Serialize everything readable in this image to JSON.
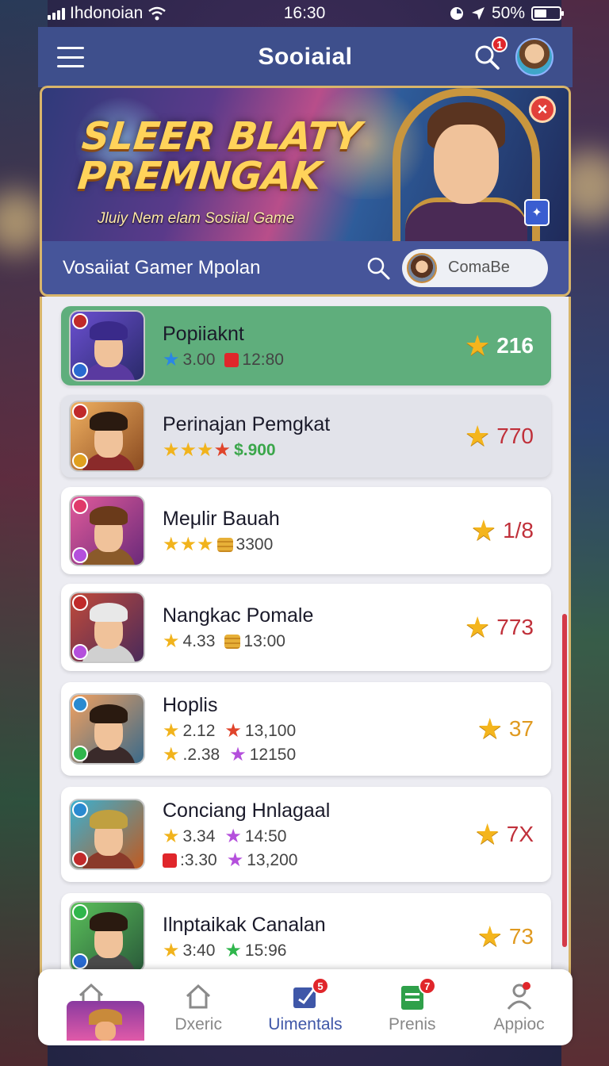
{
  "status_bar": {
    "carrier": "Ihdonoian",
    "time": "16:30",
    "battery": "50%"
  },
  "header": {
    "title": "Sooiaial",
    "search_badge": "1"
  },
  "banner": {
    "title_line1": "SLEER BLATY",
    "title_line2": "PREMNGAK",
    "subtitle": "Jluiy Nem elam Sosiial Game"
  },
  "subheader": {
    "title": "Vosaiiat Gamer Mpolan",
    "pill_label": "ComaBe"
  },
  "games": [
    {
      "name": "Popiiaknt",
      "score": "216",
      "meta": [
        [
          {
            "icon": "blue-star",
            "value": "3.00"
          },
          {
            "icon": "red-gem",
            "value": "12:80"
          }
        ]
      ]
    },
    {
      "name": "Perinajan Pemgkat",
      "score": "770",
      "meta": [
        [
          {
            "icon": "star-rating",
            "value": "$.900"
          }
        ]
      ]
    },
    {
      "name": "Meμlir Bauah",
      "score": "1/8",
      "meta": [
        [
          {
            "icon": "star-rating-3",
            "value": ""
          },
          {
            "icon": "coin",
            "value": "3300"
          }
        ]
      ]
    },
    {
      "name": "Nangkac Pomale",
      "score": "773",
      "meta": [
        [
          {
            "icon": "star",
            "value": "4.33"
          },
          {
            "icon": "coin",
            "value": "13:00"
          }
        ]
      ]
    },
    {
      "name": "Hoplis",
      "score": "37",
      "meta": [
        [
          {
            "icon": "star",
            "value": "2.12"
          },
          {
            "icon": "red-star",
            "value": "13,100"
          }
        ],
        [
          {
            "icon": "star",
            "value": ".2.38"
          },
          {
            "icon": "purple-star",
            "value": "12150"
          }
        ]
      ]
    },
    {
      "name": "Conciang Hnlagaal",
      "score": "7X",
      "meta": [
        [
          {
            "icon": "star",
            "value": "3.34"
          },
          {
            "icon": "purple-star",
            "value": "14:50"
          }
        ],
        [
          {
            "icon": "red-gem",
            "value": ":3.30"
          },
          {
            "icon": "purple-star",
            "value": "13,200"
          }
        ]
      ]
    },
    {
      "name": "Ilnptaikak Canalan",
      "score": "73",
      "meta": [
        [
          {
            "icon": "star",
            "value": "3:40"
          },
          {
            "icon": "green-star",
            "value": "15:96"
          }
        ]
      ]
    }
  ],
  "bottom_nav": {
    "items": [
      {
        "label": "",
        "icon": "home-icon",
        "badge": ""
      },
      {
        "label": "Dxeric",
        "icon": "house-outline-icon",
        "badge": ""
      },
      {
        "label": "Uimentals",
        "icon": "edit-box-icon",
        "badge": "5"
      },
      {
        "label": "Prenis",
        "icon": "clipboard-icon",
        "badge": "7"
      },
      {
        "label": "Appioc",
        "icon": "profile-icon",
        "badge": ""
      }
    ]
  }
}
